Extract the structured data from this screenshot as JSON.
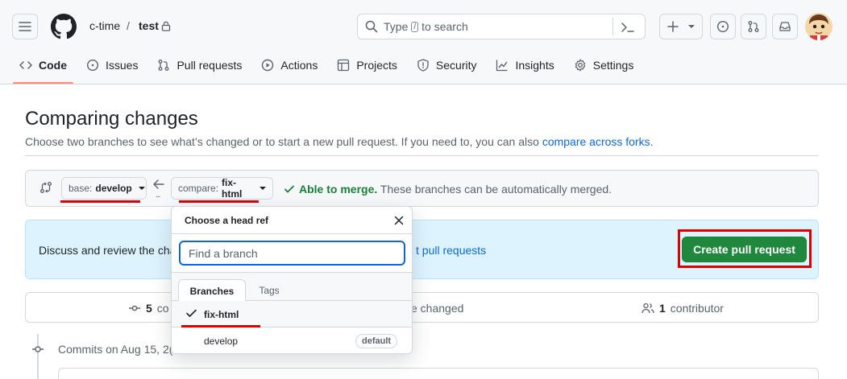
{
  "header": {
    "owner": "c-time",
    "separator": "/",
    "repo": "test",
    "search_placeholder_prefix": "Type",
    "search_shortcut": "/",
    "search_placeholder_suffix": "to search"
  },
  "nav": {
    "tabs": [
      {
        "label": "Code",
        "icon": "code-icon",
        "selected": true
      },
      {
        "label": "Issues",
        "icon": "issue-opened-icon"
      },
      {
        "label": "Pull requests",
        "icon": "git-pull-request-icon"
      },
      {
        "label": "Actions",
        "icon": "play-icon"
      },
      {
        "label": "Projects",
        "icon": "table-icon"
      },
      {
        "label": "Security",
        "icon": "shield-icon"
      },
      {
        "label": "Insights",
        "icon": "graph-icon"
      },
      {
        "label": "Settings",
        "icon": "gear-icon"
      }
    ]
  },
  "page": {
    "title": "Comparing changes",
    "subtitle": "Choose two branches to see what’s changed or to start a new pull request. If you need to, you can also",
    "subtitle_link": "compare across forks",
    "subtitle_end": "."
  },
  "range": {
    "base_prefix": "base:",
    "base_branch": "develop",
    "compare_prefix": "compare:",
    "compare_branch": "fix-html",
    "dots": "...",
    "merge_status": "Able to merge.",
    "merge_detail": "These branches can be automatically merged."
  },
  "flash": {
    "text": "Discuss and review the cha",
    "link": "t pull requests",
    "create_button": "Create pull request"
  },
  "stats": {
    "commits_count": "5",
    "commits_label": "co",
    "files_label": "e changed",
    "contributors_count": "1",
    "contributors_label": "contributor"
  },
  "timeline": {
    "commits_on": "Commits on Aug 15, 2("
  },
  "dropdown": {
    "title": "Choose a head ref",
    "filter_placeholder": "Find a branch",
    "tabs": [
      "Branches",
      "Tags"
    ],
    "items": [
      {
        "name": "fix-html",
        "selected": true
      },
      {
        "name": "develop",
        "badge": "default"
      }
    ]
  },
  "colors": {
    "accent_link": "#0969da",
    "success": "#1a7f37",
    "primary_button": "#1f883d",
    "annotation_red": "#e00000",
    "tab_underline": "#fd8c73"
  }
}
